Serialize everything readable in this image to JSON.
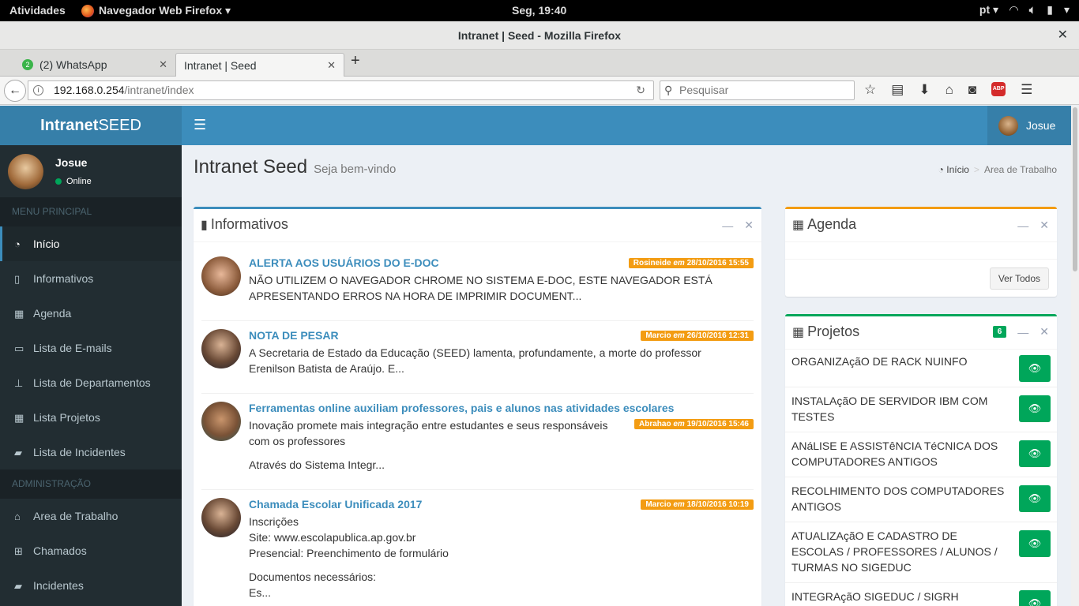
{
  "system": {
    "activities": "Atividades",
    "app_menu": "Navegador Web Firefox ▾",
    "clock": "Seg, 19:40",
    "lang": "pt ▾"
  },
  "window": {
    "title": "Intranet | Seed - Mozilla Firefox"
  },
  "tabs": [
    {
      "label": "(2) WhatsApp",
      "badge": "2"
    },
    {
      "label": "Intranet | Seed"
    }
  ],
  "address": {
    "host": "192.168.0.254",
    "path": "/intranet/index"
  },
  "search": {
    "placeholder": "Pesquisar"
  },
  "app": {
    "logo_bold": "Intranet",
    "logo_rest": "SEED",
    "user": "Josue",
    "status": "Online",
    "menu_header_1": "MENU PRINCIPAL",
    "menu_header_2": "ADMINISTRAÇÃO",
    "menu_main": [
      "Início",
      "Informativos",
      "Agenda",
      "Lista de E-mails",
      "Lista de Departamentos",
      "Lista Projetos",
      "Lista de Incidentes"
    ],
    "menu_admin": [
      "Area de Trabalho",
      "Chamados",
      "Incidentes"
    ]
  },
  "header": {
    "title": "Intranet Seed",
    "subtitle": "Seja bem-vindo",
    "bc_home": "Início",
    "bc_current": "Area de Trabalho"
  },
  "informativos": {
    "title": "Informativos",
    "items": [
      {
        "title": "ALERTA AOS USUÁRIOS DO E-DOC",
        "author": "Rosineide",
        "em": "em",
        "date": "28/10/2016 15:55",
        "body1": "NÃO UTILIZEM O NAVEGADOR CHROME NO SISTEMA E-DOC, ESTE NAVEGADOR ESTÁ",
        "body2": "APRESENTANDO ERROS NA HORA DE IMPRIMIR DOCUMENT..."
      },
      {
        "title": "NOTA DE PESAR",
        "author": "Marcio",
        "em": "em",
        "date": "26/10/2016 12:31",
        "body1": "A Secretaria de Estado da Educação (SEED) lamenta, profundamente, a morte do professor",
        "body2": "Erenilson Batista de Araújo. E..."
      },
      {
        "title": "Ferramentas online auxiliam professores, pais e alunos nas atividades escolares",
        "author": "Abrahao",
        "em": "em",
        "date": "19/10/2016 15:46",
        "body1": "Inovação promete mais integração entre estudantes e seus responsáveis",
        "body2": "com os professores",
        "body3": "Através do Sistema Integr..."
      },
      {
        "title": "Chamada Escolar Unificada 2017",
        "author": "Marcio",
        "em": "em",
        "date": "18/10/2016 10:19",
        "body1": "Inscrições",
        "body2": "Site: www.escolapublica.ap.gov.br",
        "body3": "Presencial: Preenchimento de formulário",
        "body4": "Documentos necessários:",
        "body5": "Es..."
      }
    ]
  },
  "agenda": {
    "title": "Agenda",
    "ver_todos": "Ver Todos"
  },
  "projetos": {
    "title": "Projetos",
    "count": "6",
    "items": [
      "ORGANIZAçãO DE RACK NUINFO",
      "INSTALAçãO DE SERVIDOR IBM COM TESTES",
      "ANáLISE E ASSISTêNCIA TéCNICA DOS COMPUTADORES ANTIGOS",
      "RECOLHIMENTO DOS COMPUTADORES ANTIGOS",
      "ATUALIZAçãO E CADASTRO DE ESCOLAS / PROFESSORES / ALUNOS / TURMAS NO SIGEDUC",
      "INTEGRAçãO SIGEDUC / SIGRH"
    ]
  },
  "colors": {
    "primary": "#3c8dbc",
    "sidebar": "#222d32",
    "warning": "#f39c12",
    "success": "#00a65a"
  }
}
